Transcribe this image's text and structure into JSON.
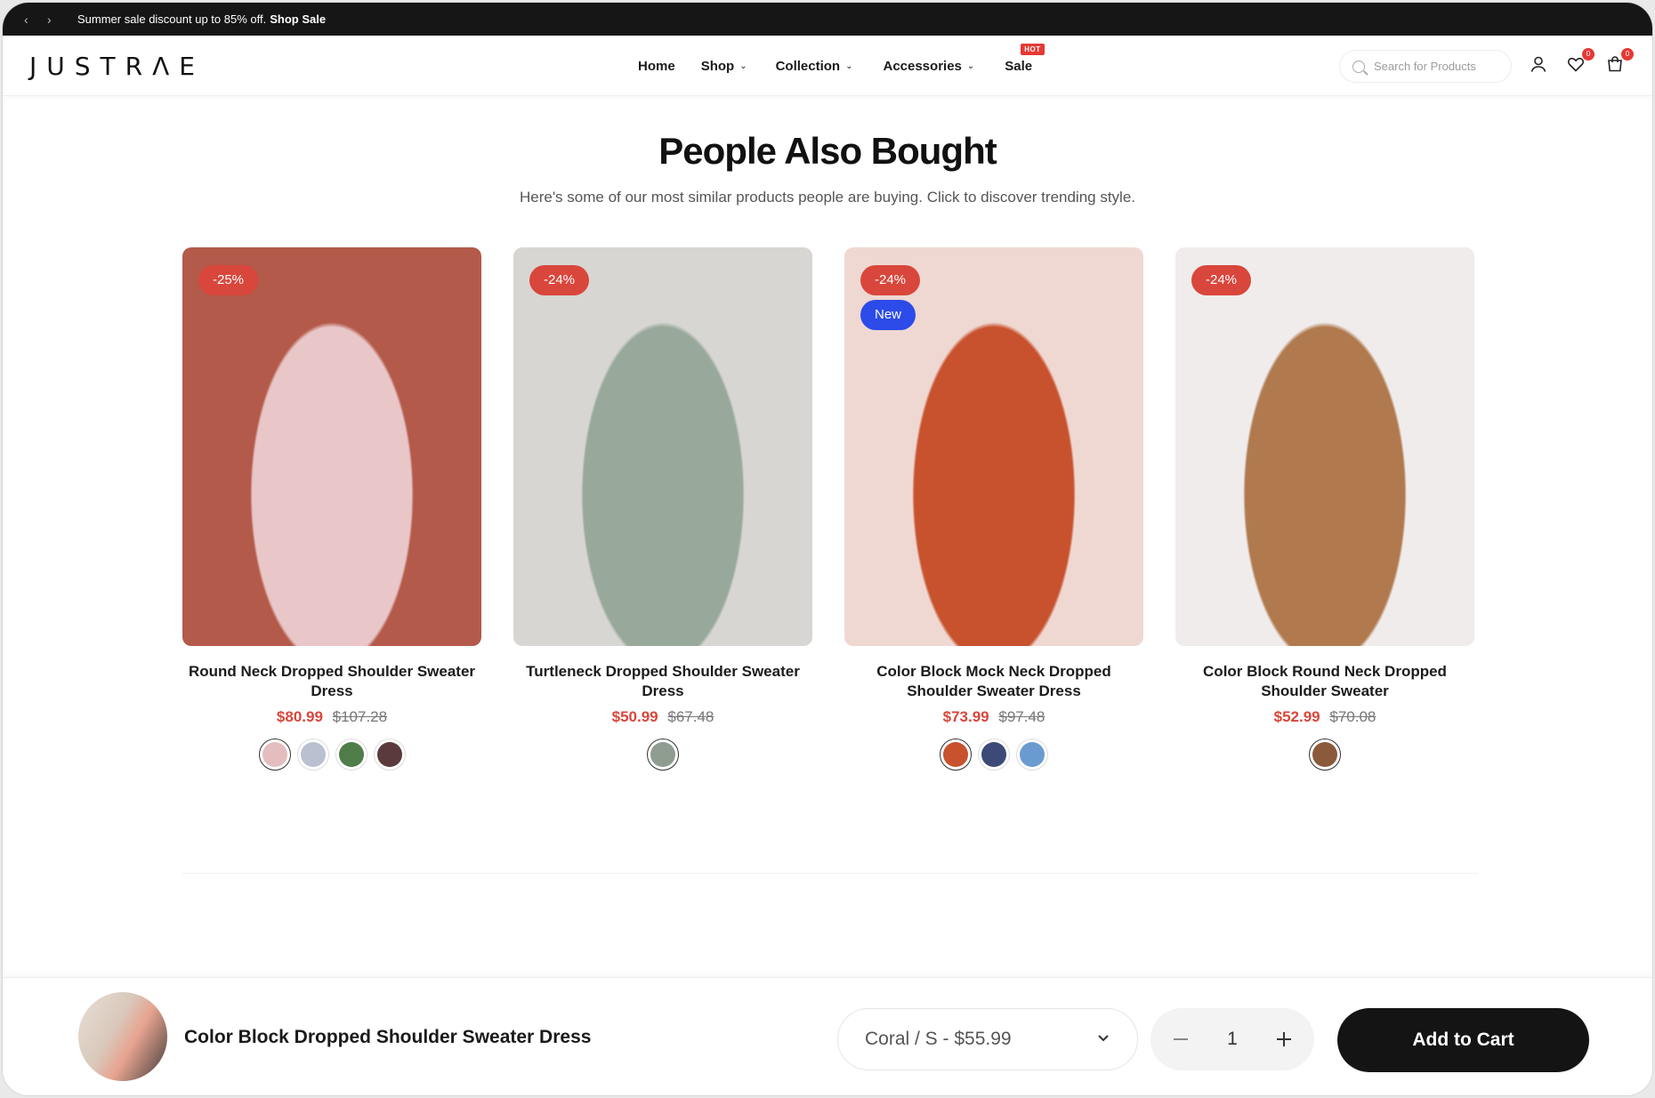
{
  "announcement": {
    "message": "Summer sale discount up to 85% off.",
    "link": "Shop Sale"
  },
  "header": {
    "logo": "JUSTRΛE",
    "nav": {
      "home": "Home",
      "shop": "Shop",
      "collection": "Collection",
      "accessories": "Accessories",
      "sale": "Sale",
      "sale_badge": "HOT"
    },
    "search_placeholder": "Search for Products",
    "wishlist_count": "0",
    "cart_count": "0"
  },
  "section": {
    "title": "People Also Bought",
    "subtitle": "Here's some of our most similar products people are buying. Click to discover trending style."
  },
  "products": [
    {
      "discount": "-25%",
      "name": "Round Neck Dropped Shoulder Sweater Dress",
      "price": "$80.99",
      "old_price": "$107.28",
      "image_colors": [
        "#b35a4a",
        "#e9c6c8"
      ],
      "swatches": [
        "#e4bdbf",
        "#b9c0cf",
        "#4f7d4a",
        "#5a3a3a"
      ]
    },
    {
      "discount": "-24%",
      "name": "Turtleneck Dropped Shoulder Sweater Dress",
      "price": "$50.99",
      "old_price": "$67.48",
      "image_colors": [
        "#d8d6d2",
        "#98a89a"
      ],
      "swatches": [
        "#8f9d91"
      ]
    },
    {
      "discount": "-24%",
      "new_badge": "New",
      "name": "Color Block Mock Neck Dropped Shoulder Sweater Dress",
      "price": "$73.99",
      "old_price": "$97.48",
      "image_colors": [
        "#efd8d2",
        "#c8522e"
      ],
      "swatches": [
        "#c8522e",
        "#3d4a78",
        "#6a9bd0"
      ]
    },
    {
      "discount": "-24%",
      "name": "Color Block Round Neck Dropped Shoulder Sweater",
      "price": "$52.99",
      "old_price": "$70.08",
      "image_colors": [
        "#f0ecec",
        "#b07a4e"
      ],
      "swatches": [
        "#8a5a3a"
      ]
    }
  ],
  "sticky": {
    "title": "Color Block Dropped Shoulder Sweater Dress",
    "variant": "Coral / S - $55.99",
    "quantity": "1",
    "add_to_cart": "Add to Cart"
  }
}
